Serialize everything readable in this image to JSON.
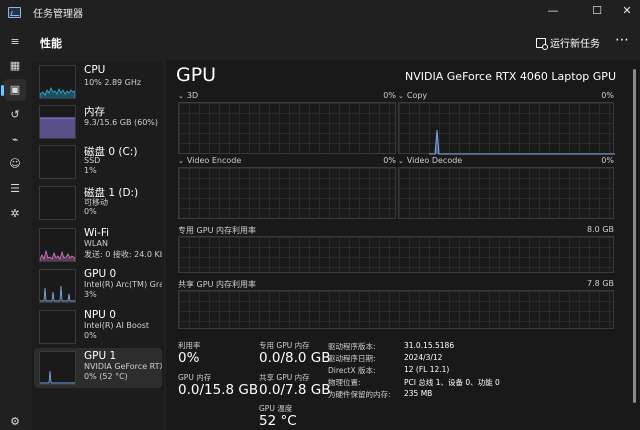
{
  "window": {
    "title": "任务管理器",
    "controls": {
      "minimize": "—",
      "maximize": "☐",
      "close": "✕"
    }
  },
  "header": {
    "page_title": "性能",
    "run_task_label": "运行新任务",
    "more_label": "⋯"
  },
  "nav": {
    "items": [
      {
        "icon": "hamburger-icon",
        "glyph": "≡"
      },
      {
        "icon": "processes-icon",
        "glyph": "▦"
      },
      {
        "icon": "performance-icon",
        "glyph": "▣"
      },
      {
        "icon": "app-history-icon",
        "glyph": "↺"
      },
      {
        "icon": "startup-icon",
        "glyph": "⌁"
      },
      {
        "icon": "users-icon",
        "glyph": "☺"
      },
      {
        "icon": "details-icon",
        "glyph": "☰"
      },
      {
        "icon": "services-icon",
        "glyph": "✲"
      }
    ],
    "settings_glyph": "⚙"
  },
  "sidebar": {
    "items": [
      {
        "name": "CPU",
        "sub1": "10%  2.89 GHz",
        "sub2": "",
        "color": "#29b6e6"
      },
      {
        "name": "内存",
        "sub1": "9.3/15.6 GB (60%)",
        "sub2": "",
        "color": "#8c7ee6"
      },
      {
        "name": "磁盘 0 (C:)",
        "sub1": "SSD",
        "sub2": "1%",
        "color": "#56c23b"
      },
      {
        "name": "磁盘 1 (D:)",
        "sub1": "可移动",
        "sub2": "0%",
        "color": "#56c23b"
      },
      {
        "name": "Wi-Fi",
        "sub1": "WLAN",
        "sub2": "发送: 0 接收: 24.0 Kbps",
        "color": "#d67ec2"
      },
      {
        "name": "GPU 0",
        "sub1": "Intel(R) Arc(TM) Graphics",
        "sub2": "3%",
        "color": "#7ea8e6"
      },
      {
        "name": "NPU 0",
        "sub1": "Intel(R) AI Boost",
        "sub2": "0%",
        "color": "#7ea8e6"
      },
      {
        "name": "GPU 1",
        "sub1": "NVIDIA GeForce RTX 4060",
        "sub2": "0% (52 °C)",
        "color": "#7ea8e6"
      }
    ]
  },
  "main": {
    "title": "GPU",
    "model": "NVIDIA GeForce RTX 4060 Laptop GPU",
    "engines": [
      {
        "label": "3D",
        "value": "0%"
      },
      {
        "label": "Copy",
        "value": "0%"
      },
      {
        "label": "Video Encode",
        "value": "0%"
      },
      {
        "label": "Video Decode",
        "value": "0%"
      }
    ],
    "dedicated_memory_graph": {
      "label": "专用 GPU 内存利用率",
      "max": "8.0 GB"
    },
    "shared_memory_graph": {
      "label": "共享 GPU 内存利用率",
      "max": "7.8 GB"
    },
    "stats": {
      "utilization_label": "利用率",
      "utilization_value": "0%",
      "gpu_memory_label": "GPU 内存",
      "gpu_memory_value": "0.0/15.8 GB",
      "dedicated_label": "专用 GPU 内存",
      "dedicated_value": "0.0/8.0 GB",
      "shared_label": "共享 GPU 内存",
      "shared_value": "0.0/7.8 GB",
      "temp_label": "GPU 温度",
      "temp_value": "52 °C"
    },
    "details": [
      {
        "key": "驱动程序版本:",
        "value": "31.0.15.5186"
      },
      {
        "key": "驱动程序日期:",
        "value": "2024/3/12"
      },
      {
        "key": "DirectX 版本:",
        "value": "12 (FL 12.1)"
      },
      {
        "key": "物理位置:",
        "value": "PCI 总线 1、设备 0、功能 0"
      },
      {
        "key": "为硬件保留的内存:",
        "value": "235 MB"
      }
    ]
  }
}
